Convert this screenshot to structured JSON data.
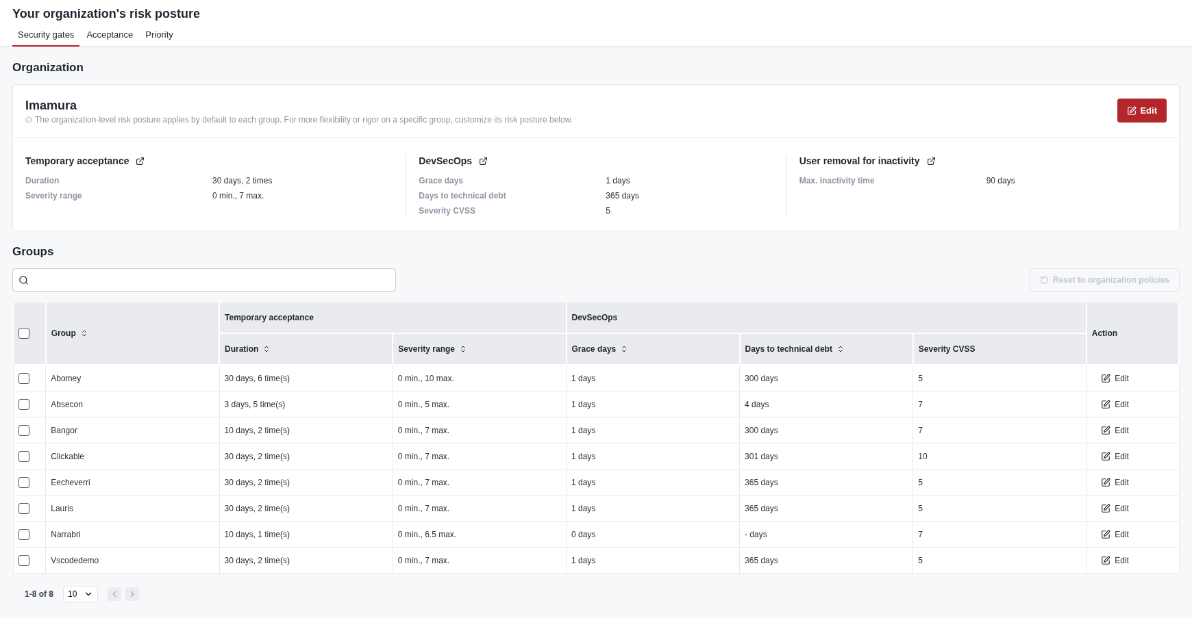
{
  "header": {
    "title": "Your organization's risk posture",
    "tabs": [
      {
        "label": "Security gates",
        "selected": true
      },
      {
        "label": "Acceptance",
        "selected": false
      },
      {
        "label": "Priority",
        "selected": false
      }
    ]
  },
  "organization": {
    "heading": "Organization",
    "name": "Imamura",
    "description": "The organization-level risk posture applies by default to each group. For more flexibility or rigor on a specific group, customize its risk posture below.",
    "edit_button": "Edit",
    "sections": [
      {
        "title": "Temporary acceptance",
        "rows": [
          {
            "label": "Duration",
            "value": "30 days, 2 times"
          },
          {
            "label": "Severity range",
            "value": "0 min., 7 max."
          }
        ]
      },
      {
        "title": "DevSecOps",
        "rows": [
          {
            "label": "Grace days",
            "value": "1 days"
          },
          {
            "label": "Days to technical debt",
            "value": "365 days"
          },
          {
            "label": "Severity CVSS",
            "value": "5"
          }
        ]
      },
      {
        "title": "User removal for inactivity",
        "rows": [
          {
            "label": "Max. inactivity time",
            "value": "90 days"
          }
        ]
      }
    ]
  },
  "groups": {
    "heading": "Groups",
    "reset_button": {
      "label": "Reset to organization policies",
      "disabled": true
    },
    "table": {
      "select_all": {
        "checked": false
      },
      "first_column": {
        "label": "Group",
        "sortable": true
      },
      "column_groups": [
        {
          "label": "Temporary acceptance",
          "columns": [
            {
              "label": "Duration",
              "sortable": true
            },
            {
              "label": "Severity range",
              "sortable": true
            }
          ]
        },
        {
          "label": "DevSecOps",
          "columns": [
            {
              "label": "Grace days",
              "sortable": true
            },
            {
              "label": "Days to technical debt",
              "sortable": true
            },
            {
              "label": "Severity CVSS",
              "sortable": false
            }
          ]
        }
      ],
      "action_column": "Action",
      "rows": [
        {
          "checked": false,
          "cells": [
            "Abomey",
            "30 days, 6 time(s)",
            "0 min., 10 max.",
            "1 days",
            "300 days",
            "5"
          ],
          "action": "Edit"
        },
        {
          "checked": false,
          "cells": [
            "Absecon",
            "3 days, 5 time(s)",
            "0 min., 5 max.",
            "1 days",
            "4 days",
            "7"
          ],
          "action": "Edit"
        },
        {
          "checked": false,
          "cells": [
            "Bangor",
            "10 days, 2 time(s)",
            "0 min., 7 max.",
            "1 days",
            "300 days",
            "7"
          ],
          "action": "Edit"
        },
        {
          "checked": false,
          "cells": [
            "Clickable",
            "30 days, 2 time(s)",
            "0 min., 7 max.",
            "1 days",
            "301 days",
            "10"
          ],
          "action": "Edit"
        },
        {
          "checked": false,
          "cells": [
            "Eecheverri",
            "30 days, 2 time(s)",
            "0 min., 7 max.",
            "1 days",
            "365 days",
            "5"
          ],
          "action": "Edit"
        },
        {
          "checked": false,
          "cells": [
            "Lauris",
            "30 days, 2 time(s)",
            "0 min., 7 max.",
            "1 days",
            "365 days",
            "5"
          ],
          "action": "Edit"
        },
        {
          "checked": false,
          "cells": [
            "Narrabri",
            "10 days, 1 time(s)",
            "0 min., 6.5 max.",
            "0 days",
            "- days",
            "7"
          ],
          "action": "Edit"
        },
        {
          "checked": false,
          "cells": [
            "Vscodedemo",
            "30 days, 2 time(s)",
            "0 min., 7 max.",
            "1 days",
            "365 days",
            "5"
          ],
          "action": "Edit"
        }
      ]
    },
    "pagination": {
      "range": "1-8 of 8",
      "page_size": "10",
      "previous": {
        "disabled": true
      },
      "next": {
        "disabled": true
      }
    }
  }
}
